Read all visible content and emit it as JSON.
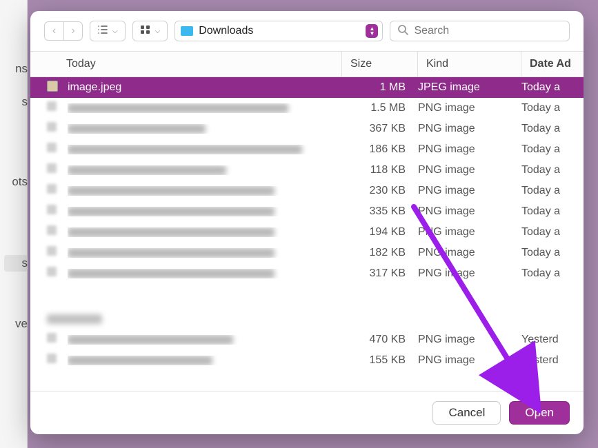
{
  "sidebar": {
    "fragments": [
      "ns",
      "s",
      "ots",
      "s",
      "ve"
    ]
  },
  "toolbar": {
    "location": "Downloads",
    "search_placeholder": "Search"
  },
  "columns": {
    "name_group": "Today",
    "size": "Size",
    "kind": "Kind",
    "date": "Date Ad"
  },
  "rows": [
    {
      "name": "image.jpeg",
      "size": "1 MB",
      "kind": "JPEG image",
      "date": "Today a",
      "selected": true,
      "blurred": false,
      "nameWidth": 0
    },
    {
      "name": "",
      "size": "1.5 MB",
      "kind": "PNG image",
      "date": "Today a",
      "selected": false,
      "blurred": true,
      "nameWidth": 320
    },
    {
      "name": "",
      "size": "367 KB",
      "kind": "PNG image",
      "date": "Today a",
      "selected": false,
      "blurred": true,
      "nameWidth": 200
    },
    {
      "name": "",
      "size": "186 KB",
      "kind": "PNG image",
      "date": "Today a",
      "selected": false,
      "blurred": true,
      "nameWidth": 340
    },
    {
      "name": "",
      "size": "118 KB",
      "kind": "PNG image",
      "date": "Today a",
      "selected": false,
      "blurred": true,
      "nameWidth": 230
    },
    {
      "name": "",
      "size": "230 KB",
      "kind": "PNG image",
      "date": "Today a",
      "selected": false,
      "blurred": true,
      "nameWidth": 300
    },
    {
      "name": "",
      "size": "335 KB",
      "kind": "PNG image",
      "date": "Today a",
      "selected": false,
      "blurred": true,
      "nameWidth": 300
    },
    {
      "name": "",
      "size": "194 KB",
      "kind": "PNG image",
      "date": "Today a",
      "selected": false,
      "blurred": true,
      "nameWidth": 300
    },
    {
      "name": "",
      "size": "182 KB",
      "kind": "PNG image",
      "date": "Today a",
      "selected": false,
      "blurred": true,
      "nameWidth": 300
    },
    {
      "name": "",
      "size": "317 KB",
      "kind": "PNG image",
      "date": "Today a",
      "selected": false,
      "blurred": true,
      "nameWidth": 300
    }
  ],
  "rows2": [
    {
      "name": "",
      "size": "470 KB",
      "kind": "PNG image",
      "date": "Yesterd",
      "selected": false,
      "blurred": true,
      "nameWidth": 240
    },
    {
      "name": "",
      "size": "155 KB",
      "kind": "PNG image",
      "date": "Yesterd",
      "selected": false,
      "blurred": true,
      "nameWidth": 210
    }
  ],
  "footer": {
    "cancel": "Cancel",
    "open": "Open"
  }
}
